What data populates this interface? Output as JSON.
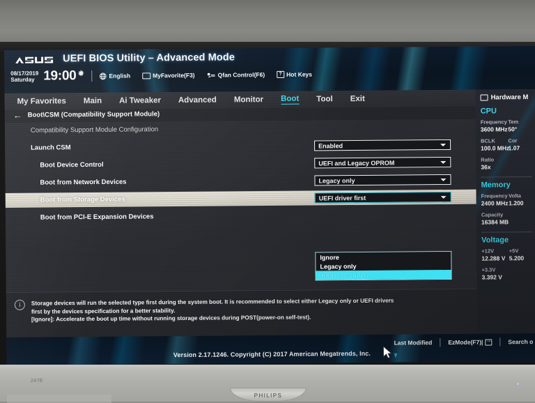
{
  "monitor": {
    "model": "247E",
    "brand": "PHILIPS"
  },
  "header": {
    "logo": "asus-logo",
    "title": "UEFI BIOS Utility – Advanced Mode",
    "date": "08/17/2019",
    "weekday": "Saturday",
    "time": "19:00",
    "gear_icon": "gear-icon",
    "items": [
      {
        "icon": "globe-icon",
        "label": "English"
      },
      {
        "icon": "star-icon",
        "label": "MyFavorite(F3)"
      },
      {
        "icon": "fan-icon",
        "label": "Qfan Control(F6)"
      },
      {
        "icon": "question-icon",
        "label": "Hot Keys"
      }
    ]
  },
  "menu": {
    "items": [
      {
        "label": "My Favorites",
        "active": false
      },
      {
        "label": "Main",
        "active": false
      },
      {
        "label": "Ai Tweaker",
        "active": false
      },
      {
        "label": "Advanced",
        "active": false
      },
      {
        "label": "Monitor",
        "active": false
      },
      {
        "label": "Boot",
        "active": true
      },
      {
        "label": "Tool",
        "active": false
      },
      {
        "label": "Exit",
        "active": false
      }
    ]
  },
  "breadcrumb": {
    "back_icon": "back-arrow-icon",
    "path": "Boot\\CSM (Compatibility Support Module)"
  },
  "main": {
    "section_title": "Compatibility Support Module Configuration",
    "rows": [
      {
        "label": "Launch CSM",
        "value": "Enabled",
        "indent": 0,
        "highlight": false,
        "focus": false
      },
      {
        "label": "Boot Device Control",
        "value": "UEFI and Legacy OPROM",
        "indent": 1,
        "highlight": false,
        "focus": false
      },
      {
        "label": "Boot from Network Devices",
        "value": "Legacy only",
        "indent": 1,
        "highlight": false,
        "focus": false
      },
      {
        "label": "Boot from Storage Devices",
        "value": "UEFI driver first",
        "indent": 1,
        "highlight": true,
        "focus": true
      },
      {
        "label": "Boot from PCI-E Expansion Devices",
        "value": "",
        "indent": 1,
        "highlight": false,
        "focus": false
      }
    ],
    "dropdown": {
      "open": true,
      "options": [
        "Ignore",
        "Legacy only",
        "UEFI driver first"
      ],
      "selected_index": 2,
      "highlight_color": "#3fe0f2"
    },
    "cursor_icon": "mouse-pointer-icon"
  },
  "help": {
    "icon": "info-icon",
    "line1": "Storage devices will run the selected type first during the system boot. It is recommended to select either Legacy only or UEFI drivers",
    "line2": "first by the devices specification for a better stability.",
    "line3": "[Ignore]: Accelerate the boot up time without running storage devices during POST(power-on self-test)."
  },
  "hardware_monitor": {
    "icon": "monitor-icon",
    "title": "Hardware M",
    "sections": [
      {
        "name": "CPU",
        "entries": [
          {
            "key": "Frequency",
            "value": "3600 MHz"
          },
          {
            "key": "Tem",
            "value": "50°"
          },
          {
            "key": "BCLK",
            "value": "100.0 MHz"
          },
          {
            "key": "Cor",
            "value": "1.07"
          },
          {
            "key": "Ratio",
            "value": "36x"
          }
        ]
      },
      {
        "name": "Memory",
        "entries": [
          {
            "key": "Frequency",
            "value": "2400 MHz"
          },
          {
            "key": "Volta",
            "value": "1.200"
          },
          {
            "key": "Capacity",
            "value": "16384 MB"
          }
        ]
      },
      {
        "name": "Voltage",
        "entries": [
          {
            "key": "+12V",
            "value": "12.288 V"
          },
          {
            "key": "+5V",
            "value": "5.200"
          },
          {
            "key": "+3.3V",
            "value": "3.392 V"
          }
        ]
      }
    ]
  },
  "footer": {
    "last_modified": "Last Modified",
    "ezmode": "EzMode(F7)|",
    "ezmode_icon": "exit-arrow-icon",
    "search": "Search o",
    "version": "Version 2.17.1246. Copyright (C) 2017 American Megatrends, Inc."
  },
  "colors": {
    "accent_cyan": "#3fd8ef",
    "panel_bg": "#2b2d33",
    "highlight_row": "#ddd9cd",
    "header_blue": "#0a1522"
  }
}
